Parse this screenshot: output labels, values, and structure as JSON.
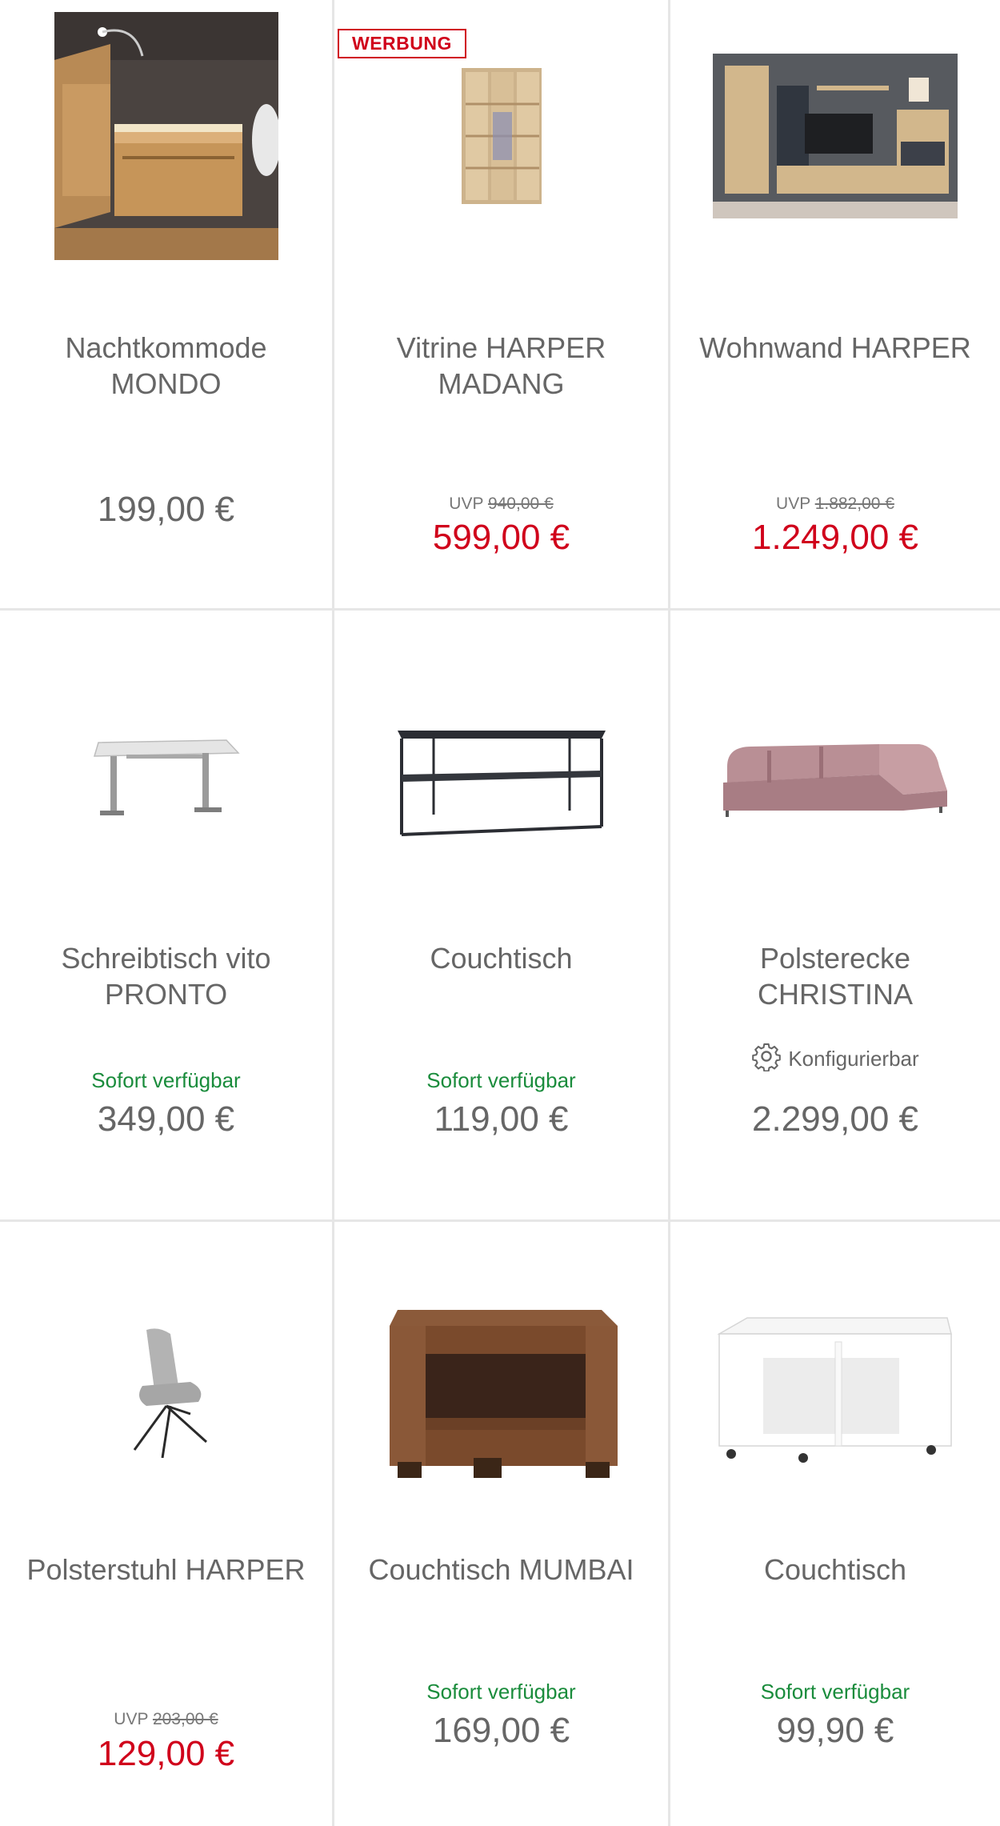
{
  "ad_badge": "WERBUNG",
  "uvp_label": "UVP",
  "config_label": "Konfigurierbar",
  "products": [
    {
      "title": "Nachtkommode MONDO",
      "price": "199,00 €"
    },
    {
      "title": "Vitrine HARPER MADANG",
      "uvp": "940,00 €",
      "price": "599,00 €"
    },
    {
      "title": "Wohnwand HARPER",
      "uvp": "1.882,00 €",
      "price": "1.249,00 €"
    },
    {
      "title": "Schreibtisch vito PRONTO",
      "availability": "Sofort verfügbar",
      "price": "349,00 €"
    },
    {
      "title": "Couchtisch",
      "availability": "Sofort verfügbar",
      "price": "119,00 €"
    },
    {
      "title": "Polsterecke CHRISTINA",
      "price": "2.299,00 €"
    },
    {
      "title": "Polsterstuhl HARPER",
      "uvp": "203,00 €",
      "price": "129,00 €"
    },
    {
      "title": "Couchtisch MUMBAI",
      "availability": "Sofort verfügbar",
      "price": "169,00 €"
    },
    {
      "title": "Couchtisch",
      "availability": "Sofort verfügbar",
      "price": "99,90 €"
    }
  ]
}
